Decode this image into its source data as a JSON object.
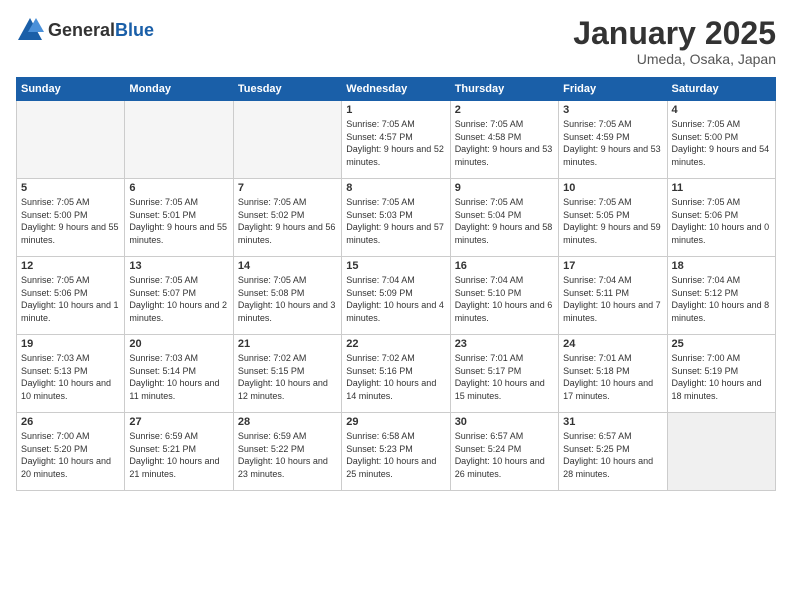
{
  "header": {
    "logo_general": "General",
    "logo_blue": "Blue",
    "title": "January 2025",
    "subtitle": "Umeda, Osaka, Japan"
  },
  "days_of_week": [
    "Sunday",
    "Monday",
    "Tuesday",
    "Wednesday",
    "Thursday",
    "Friday",
    "Saturday"
  ],
  "weeks": [
    [
      {
        "day": "",
        "empty": true
      },
      {
        "day": "",
        "empty": true
      },
      {
        "day": "",
        "empty": true
      },
      {
        "day": "1",
        "sunrise": "7:05 AM",
        "sunset": "4:57 PM",
        "daylight": "9 hours and 52 minutes."
      },
      {
        "day": "2",
        "sunrise": "7:05 AM",
        "sunset": "4:58 PM",
        "daylight": "9 hours and 53 minutes."
      },
      {
        "day": "3",
        "sunrise": "7:05 AM",
        "sunset": "4:59 PM",
        "daylight": "9 hours and 53 minutes."
      },
      {
        "day": "4",
        "sunrise": "7:05 AM",
        "sunset": "5:00 PM",
        "daylight": "9 hours and 54 minutes."
      }
    ],
    [
      {
        "day": "5",
        "sunrise": "7:05 AM",
        "sunset": "5:00 PM",
        "daylight": "9 hours and 55 minutes."
      },
      {
        "day": "6",
        "sunrise": "7:05 AM",
        "sunset": "5:01 PM",
        "daylight": "9 hours and 55 minutes."
      },
      {
        "day": "7",
        "sunrise": "7:05 AM",
        "sunset": "5:02 PM",
        "daylight": "9 hours and 56 minutes."
      },
      {
        "day": "8",
        "sunrise": "7:05 AM",
        "sunset": "5:03 PM",
        "daylight": "9 hours and 57 minutes."
      },
      {
        "day": "9",
        "sunrise": "7:05 AM",
        "sunset": "5:04 PM",
        "daylight": "9 hours and 58 minutes."
      },
      {
        "day": "10",
        "sunrise": "7:05 AM",
        "sunset": "5:05 PM",
        "daylight": "9 hours and 59 minutes."
      },
      {
        "day": "11",
        "sunrise": "7:05 AM",
        "sunset": "5:06 PM",
        "daylight": "10 hours and 0 minutes."
      }
    ],
    [
      {
        "day": "12",
        "sunrise": "7:05 AM",
        "sunset": "5:06 PM",
        "daylight": "10 hours and 1 minute."
      },
      {
        "day": "13",
        "sunrise": "7:05 AM",
        "sunset": "5:07 PM",
        "daylight": "10 hours and 2 minutes."
      },
      {
        "day": "14",
        "sunrise": "7:05 AM",
        "sunset": "5:08 PM",
        "daylight": "10 hours and 3 minutes."
      },
      {
        "day": "15",
        "sunrise": "7:04 AM",
        "sunset": "5:09 PM",
        "daylight": "10 hours and 4 minutes."
      },
      {
        "day": "16",
        "sunrise": "7:04 AM",
        "sunset": "5:10 PM",
        "daylight": "10 hours and 6 minutes."
      },
      {
        "day": "17",
        "sunrise": "7:04 AM",
        "sunset": "5:11 PM",
        "daylight": "10 hours and 7 minutes."
      },
      {
        "day": "18",
        "sunrise": "7:04 AM",
        "sunset": "5:12 PM",
        "daylight": "10 hours and 8 minutes."
      }
    ],
    [
      {
        "day": "19",
        "sunrise": "7:03 AM",
        "sunset": "5:13 PM",
        "daylight": "10 hours and 10 minutes."
      },
      {
        "day": "20",
        "sunrise": "7:03 AM",
        "sunset": "5:14 PM",
        "daylight": "10 hours and 11 minutes."
      },
      {
        "day": "21",
        "sunrise": "7:02 AM",
        "sunset": "5:15 PM",
        "daylight": "10 hours and 12 minutes."
      },
      {
        "day": "22",
        "sunrise": "7:02 AM",
        "sunset": "5:16 PM",
        "daylight": "10 hours and 14 minutes."
      },
      {
        "day": "23",
        "sunrise": "7:01 AM",
        "sunset": "5:17 PM",
        "daylight": "10 hours and 15 minutes."
      },
      {
        "day": "24",
        "sunrise": "7:01 AM",
        "sunset": "5:18 PM",
        "daylight": "10 hours and 17 minutes."
      },
      {
        "day": "25",
        "sunrise": "7:00 AM",
        "sunset": "5:19 PM",
        "daylight": "10 hours and 18 minutes."
      }
    ],
    [
      {
        "day": "26",
        "sunrise": "7:00 AM",
        "sunset": "5:20 PM",
        "daylight": "10 hours and 20 minutes."
      },
      {
        "day": "27",
        "sunrise": "6:59 AM",
        "sunset": "5:21 PM",
        "daylight": "10 hours and 21 minutes."
      },
      {
        "day": "28",
        "sunrise": "6:59 AM",
        "sunset": "5:22 PM",
        "daylight": "10 hours and 23 minutes."
      },
      {
        "day": "29",
        "sunrise": "6:58 AM",
        "sunset": "5:23 PM",
        "daylight": "10 hours and 25 minutes."
      },
      {
        "day": "30",
        "sunrise": "6:57 AM",
        "sunset": "5:24 PM",
        "daylight": "10 hours and 26 minutes."
      },
      {
        "day": "31",
        "sunrise": "6:57 AM",
        "sunset": "5:25 PM",
        "daylight": "10 hours and 28 minutes."
      },
      {
        "day": "",
        "empty": true,
        "shaded": true
      }
    ]
  ]
}
